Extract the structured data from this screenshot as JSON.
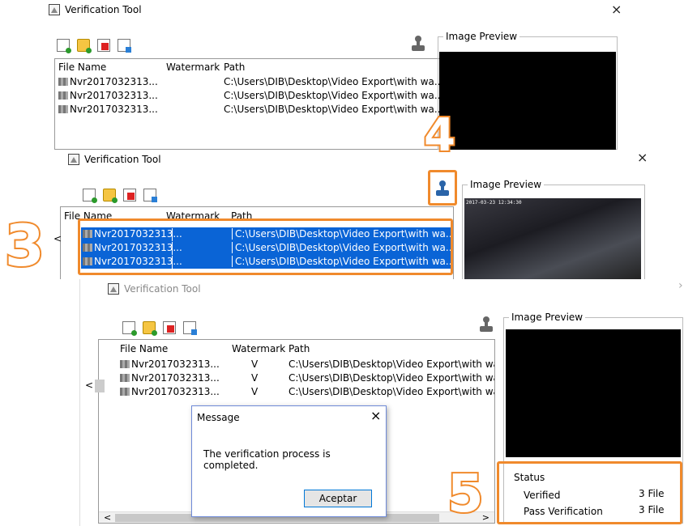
{
  "app_title": "Verification Tool",
  "close_glyph": "×",
  "columns": {
    "file_name": "File Name",
    "watermark": "Watermark",
    "path": "Path"
  },
  "preview_label": "Image Preview",
  "files": [
    {
      "name": "Nvr2017032313...",
      "watermark": "",
      "path": "C:\\Users\\DIB\\Desktop\\Video Export\\with wa..."
    },
    {
      "name": "Nvr2017032313...",
      "watermark": "",
      "path": "C:\\Users\\DIB\\Desktop\\Video Export\\with wa..."
    },
    {
      "name": "Nvr2017032313...",
      "watermark": "",
      "path": "C:\\Users\\DIB\\Desktop\\Video Export\\with wa..."
    }
  ],
  "verified_files": [
    {
      "name": "Nvr2017032313...",
      "watermark": "V",
      "path": "C:\\Users\\DIB\\Desktop\\Video Export\\with wa..."
    },
    {
      "name": "Nvr2017032313...",
      "watermark": "V",
      "path": "C:\\Users\\DIB\\Desktop\\Video Export\\with wa..."
    },
    {
      "name": "Nvr2017032313...",
      "watermark": "V",
      "path": "C:\\Users\\DIB\\Desktop\\Video Export\\with wa..."
    }
  ],
  "step_labels": {
    "three": "3",
    "four": "4",
    "five": "5"
  },
  "preview_overlay": "2017-03-23 12:34:30",
  "message_dialog": {
    "title": "Message",
    "text": "The verification process is completed.",
    "ok_label": "Aceptar"
  },
  "status": {
    "heading": "Status",
    "verified_label": "Verified",
    "verified_value": "3 File",
    "pass_label": "Pass Verification",
    "pass_value": "3 File"
  },
  "scroll": {
    "left": "<",
    "right": ">"
  },
  "colors": {
    "accent": "#f08a2c",
    "selection": "#0a64d6"
  },
  "icons": [
    "add-file-icon",
    "add-folder-icon",
    "remove-file-icon",
    "export-file-icon",
    "stamp-icon"
  ]
}
